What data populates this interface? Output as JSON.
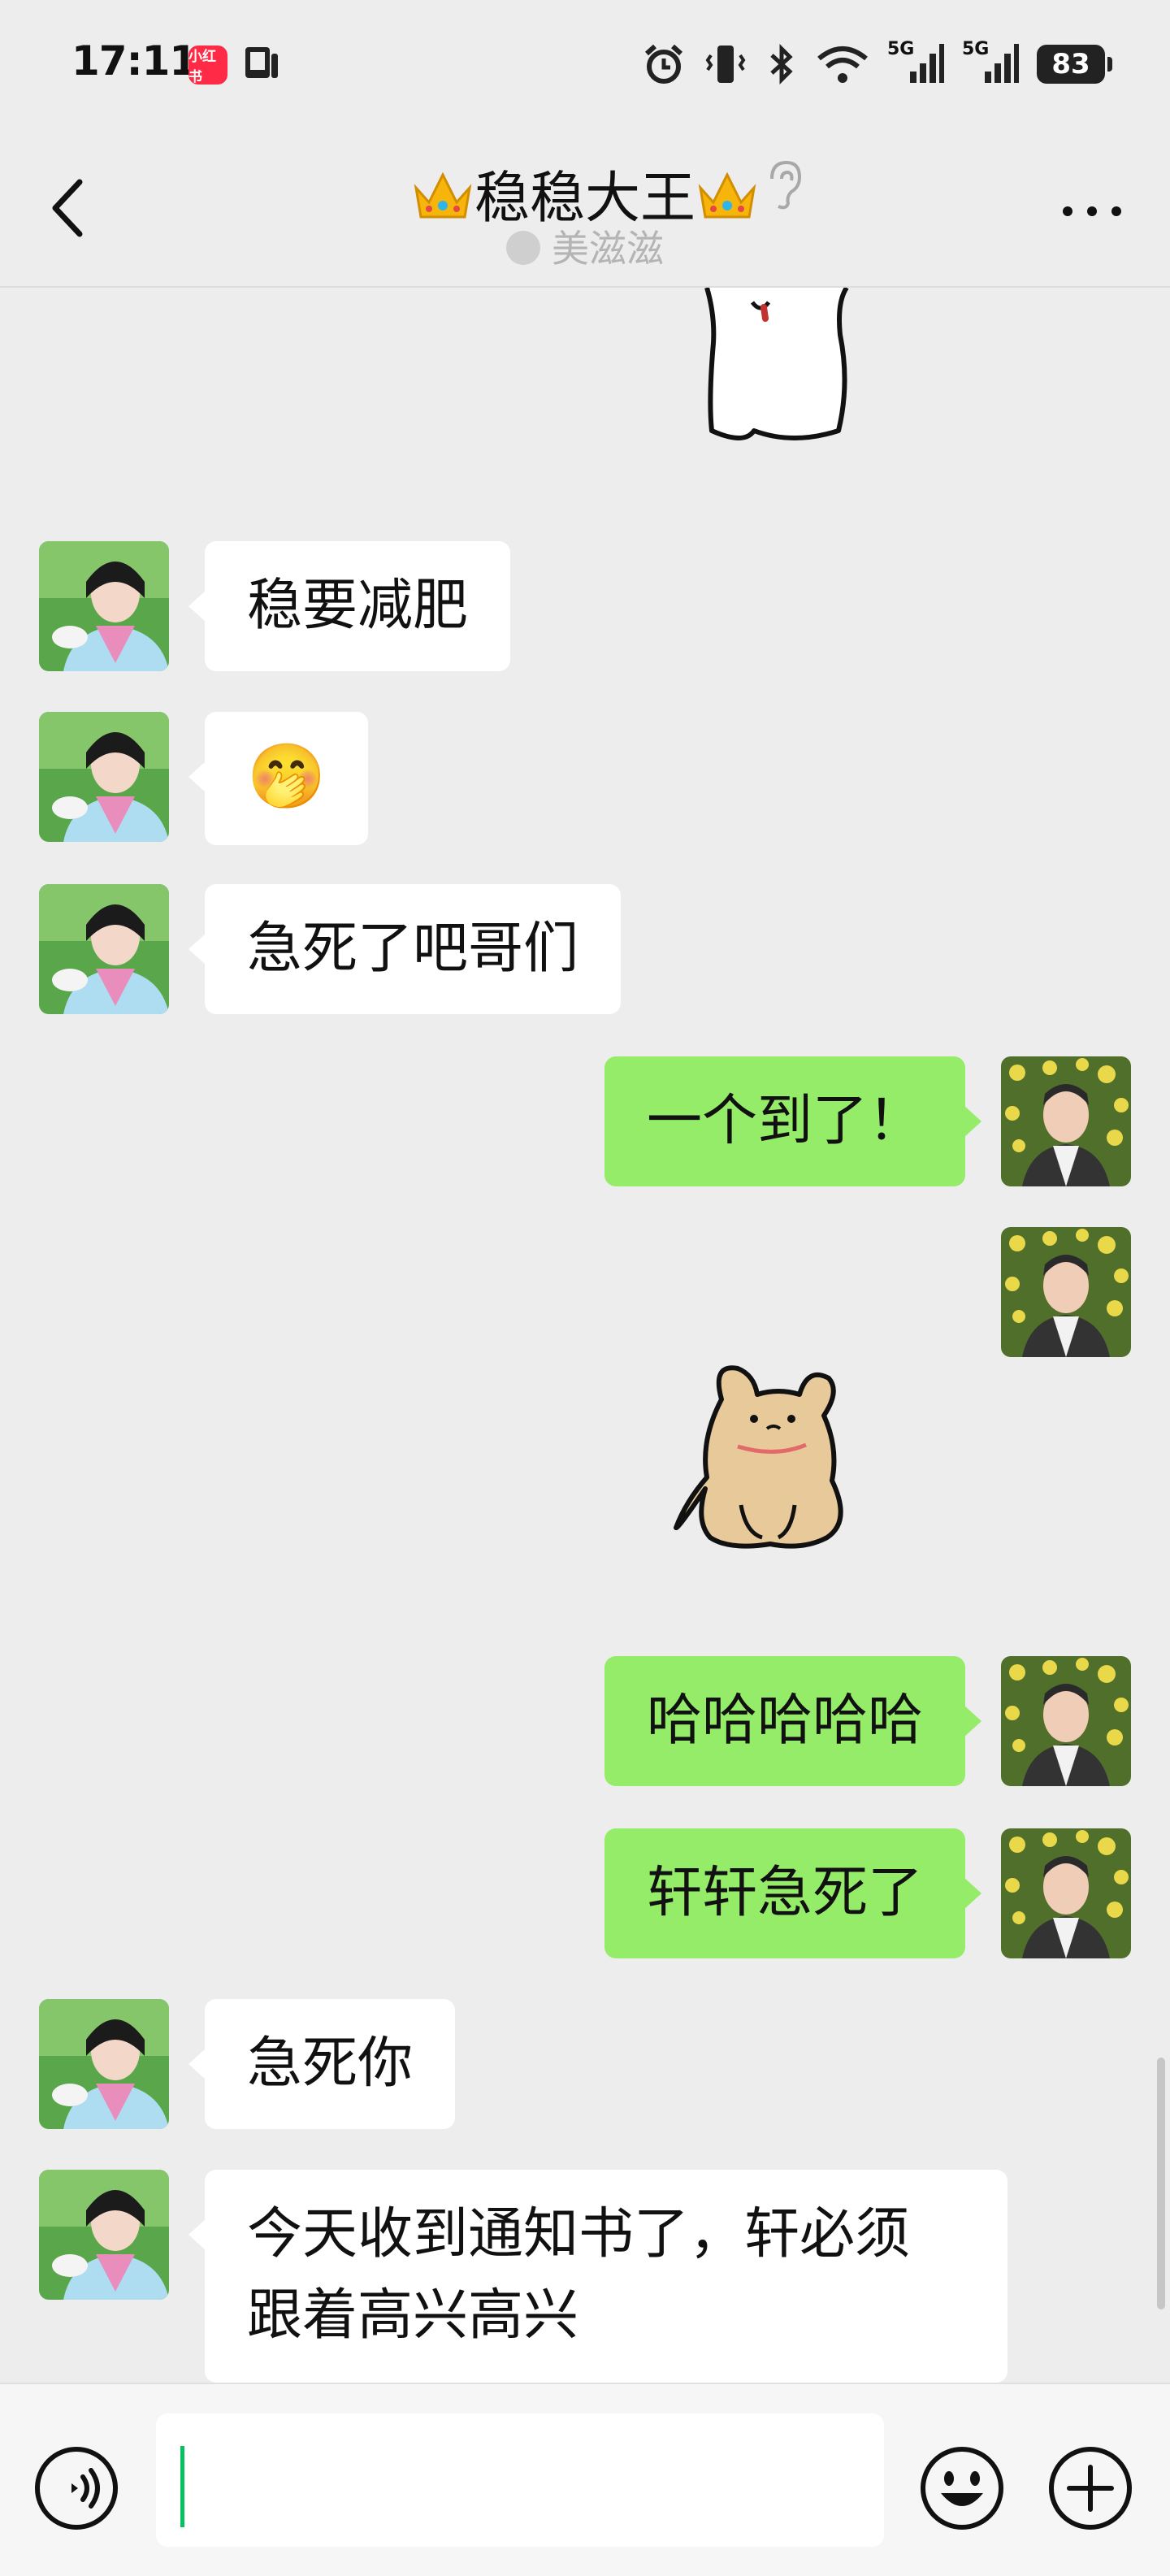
{
  "status_bar": {
    "time": "17:11",
    "app_badge": "小红书",
    "network_1": "5G",
    "network_2": "5G",
    "battery": "83"
  },
  "header": {
    "title": "稳稳大王",
    "subtitle": "美滋滋"
  },
  "messages": [
    {
      "side": "in",
      "text": "稳要减肥"
    },
    {
      "side": "in",
      "text": "🤭"
    },
    {
      "side": "in",
      "text": "急死了吧哥们"
    },
    {
      "side": "out",
      "text": "一个到了！"
    },
    {
      "side": "out",
      "text": "哈哈哈哈哈"
    },
    {
      "side": "out",
      "text": "轩轩急死了"
    },
    {
      "side": "in",
      "text": "急死你"
    },
    {
      "side": "in",
      "text": "今天收到通知书了，轩必须\n跟着高兴高兴"
    }
  ],
  "colors": {
    "background": "#ededed",
    "incoming_bubble": "#ffffff",
    "outgoing_bubble": "#95ec69",
    "caret": "#07c160"
  },
  "icons": [
    "back-chevron-icon",
    "crown-icon",
    "ear-icon",
    "more-dots-icon",
    "voice-icon",
    "emoji-icon",
    "plus-icon"
  ]
}
